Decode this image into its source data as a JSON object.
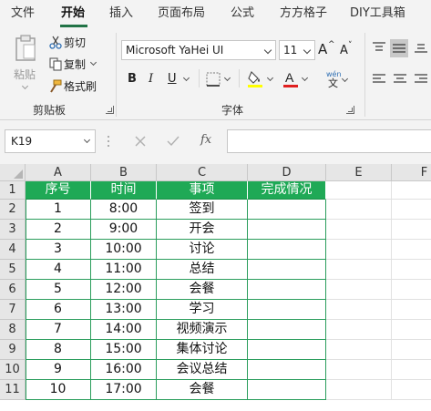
{
  "menu": {
    "items": [
      "文件",
      "开始",
      "插入",
      "页面布局",
      "公式",
      "方方格子",
      "DIY工具箱"
    ],
    "active": "开始"
  },
  "clipboard": {
    "paste_label": "粘贴",
    "cut_label": "剪切",
    "copy_label": "复制",
    "format_painter_label": "格式刷",
    "group_label": "剪贴板"
  },
  "font": {
    "name": "Microsoft YaHei UI",
    "size": "11",
    "group_label": "字体",
    "bold_label": "B",
    "italic_label": "I",
    "underline_label": "U",
    "grow_label": "A",
    "shrink_label": "A",
    "phonetic_top": "wén",
    "phonetic_bottom": "文",
    "highlight_color": "#ffff00",
    "font_color": "#e01f1f"
  },
  "formula_bar": {
    "name_box": "K19",
    "fx_label": "fx",
    "value": ""
  },
  "sheet": {
    "columns": [
      "A",
      "B",
      "C",
      "D",
      "E",
      "F"
    ],
    "rows": [
      "1",
      "2",
      "3",
      "4",
      "5",
      "6",
      "7",
      "8",
      "9",
      "10",
      "11"
    ],
    "headers": [
      "序号",
      "时间",
      "事项",
      "完成情况"
    ],
    "data": [
      [
        "1",
        "8:00",
        "签到",
        ""
      ],
      [
        "2",
        "9:00",
        "开会",
        ""
      ],
      [
        "3",
        "10:00",
        "讨论",
        ""
      ],
      [
        "4",
        "11:00",
        "总结",
        ""
      ],
      [
        "5",
        "12:00",
        "会餐",
        ""
      ],
      [
        "6",
        "13:00",
        "学习",
        ""
      ],
      [
        "7",
        "14:00",
        "视频演示",
        ""
      ],
      [
        "8",
        "15:00",
        "集体讨论",
        ""
      ],
      [
        "9",
        "16:00",
        "会议总结",
        ""
      ],
      [
        "10",
        "17:00",
        "会餐",
        ""
      ]
    ],
    "header_fill": "#1fa956",
    "border_color": "#2a9d5c"
  }
}
